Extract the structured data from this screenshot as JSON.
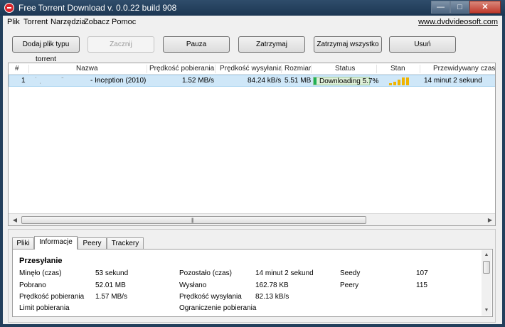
{
  "window": {
    "title": "Free Torrent Download v. 0.0.22 build 908"
  },
  "menu": {
    "items": [
      "Plik",
      "Torrent",
      "Narzędzia",
      "Zobacz",
      "Pomoc"
    ],
    "link": "www.dvdvideosoft.com"
  },
  "toolbar": {
    "add": "Dodaj plik typu torrent",
    "start": "Zacznij",
    "pause": "Pauza",
    "stop": "Zatrzymaj",
    "stop_all": "Zatrzymaj wszystko",
    "remove": "Usuń"
  },
  "list": {
    "columns": [
      "#",
      "Nazwa",
      "Prędkość pobierania",
      "Prędkość wysyłania",
      "Rozmiar",
      "Status",
      "Stan",
      "Przewidywany czas"
    ],
    "rows": [
      {
        "index": "1",
        "name": "- Inception (2010)",
        "download_speed": "1.52 MB/s",
        "upload_speed": "84.24 kB/s",
        "size": "5.51 MB",
        "status": "Downloading 5.7%",
        "progress_percent": 5.7,
        "eta": "14 minut 2 sekund"
      }
    ]
  },
  "tabs": [
    "Pliki",
    "Informacje",
    "Peery",
    "Trackery"
  ],
  "info": {
    "section": "Przesyłanie",
    "elapsed_label": "Minęło (czas)",
    "elapsed_value": "53 sekund",
    "remaining_label": "Pozostało (czas)",
    "remaining_value": "14 minut 2 sekund",
    "seeds_label": "Seedy",
    "seeds_value": "107",
    "downloaded_label": "Pobrano",
    "downloaded_value": "52.01 MB",
    "uploaded_label": "Wysłano",
    "uploaded_value": "162.78 KB",
    "peers_label": "Peery",
    "peers_value": "115",
    "dl_speed_label": "Prędkość pobierania",
    "dl_speed_value": "1.57 MB/s",
    "ul_speed_label": "Prędkość wysyłania",
    "ul_speed_value": "82.13 kB/s",
    "dl_limit_label": "Limit pobierania",
    "ul_limit_label": "Ograniczenie pobierania"
  },
  "colors": {
    "titlebar": "#1c3652",
    "selection": "#cfe7f8",
    "progress": "#1fb055",
    "signal": "#f0b400"
  }
}
